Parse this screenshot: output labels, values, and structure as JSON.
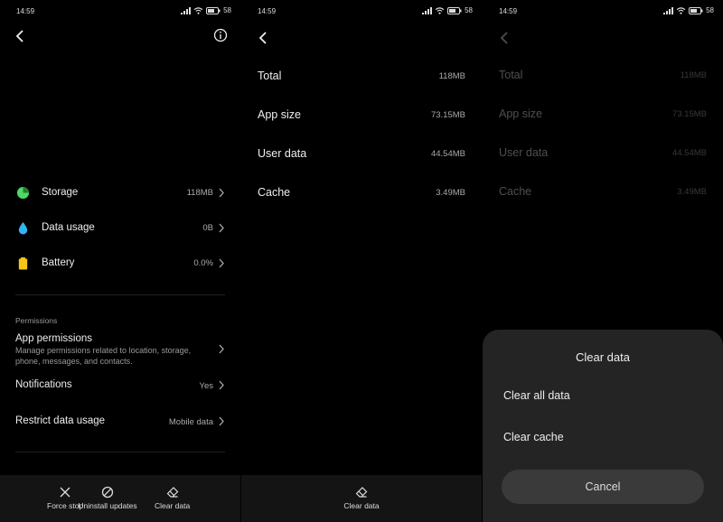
{
  "status_bar": {
    "time": "14:59",
    "battery_pct": "58"
  },
  "panel1": {
    "summary": [
      {
        "label": "Storage",
        "value": "118MB",
        "icon": "pie-chart-icon",
        "color": "#4cd964"
      },
      {
        "label": "Data usage",
        "value": "0B",
        "icon": "water-drop-icon",
        "color": "#34b4f0"
      },
      {
        "label": "Battery",
        "value": "0.0%",
        "icon": "battery-icon",
        "color": "#f5c518"
      }
    ],
    "permissions_header": "Permissions",
    "app_permissions": {
      "label": "App permissions",
      "description_line1": "Manage permissions related to location, storage,",
      "description_line2": "phone, messages, and contacts."
    },
    "notifications": {
      "label": "Notifications",
      "value": "Yes"
    },
    "restrict": {
      "label": "Restrict data usage",
      "value": "Mobile data"
    },
    "bottom_actions": [
      "Force stop",
      "Uninstall updates",
      "Clear data"
    ]
  },
  "storage_details": {
    "rows": [
      {
        "label": "Total",
        "value": "118MB"
      },
      {
        "label": "App size",
        "value": "73.15MB"
      },
      {
        "label": "User data",
        "value": "44.54MB"
      },
      {
        "label": "Cache",
        "value": "3.49MB"
      }
    ],
    "bottom_action": "Clear data"
  },
  "dialog": {
    "title": "Clear data",
    "options": [
      "Clear all data",
      "Clear cache"
    ],
    "cancel": "Cancel"
  }
}
